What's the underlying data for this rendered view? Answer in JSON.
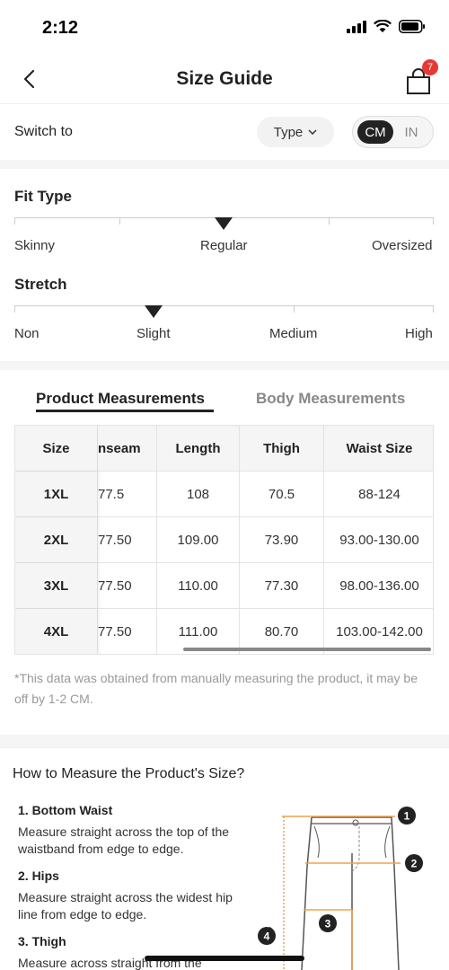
{
  "status_bar": {
    "time": "2:12"
  },
  "nav": {
    "title": "Size Guide",
    "cart_count": "7"
  },
  "switch_row": {
    "label": "Switch to",
    "type_label": "Type",
    "unit_active": "CM",
    "unit_inactive": "IN"
  },
  "fit_type": {
    "title": "Fit Type",
    "labels": [
      "Skinny",
      "Regular",
      "Oversized"
    ],
    "selected": "Regular"
  },
  "stretch": {
    "title": "Stretch",
    "labels": [
      "Non",
      "Slight",
      "Medium",
      "High"
    ],
    "selected": "Slight"
  },
  "tabs": {
    "active": "Product Measurements",
    "inactive": "Body Measurements"
  },
  "table": {
    "headers": [
      "Size",
      "nseam",
      "Length",
      "Thigh",
      "Waist Size"
    ],
    "rows": [
      [
        "1XL",
        "77.5",
        "108",
        "70.5",
        "88-124"
      ],
      [
        "2XL",
        "77.50",
        "109.00",
        "73.90",
        "93.00-130.00"
      ],
      [
        "3XL",
        "77.50",
        "110.00",
        "77.30",
        "98.00-136.00"
      ],
      [
        "4XL",
        "77.50",
        "111.00",
        "80.70",
        "103.00-142.00"
      ]
    ]
  },
  "note": "*This data was obtained from manually measuring the product, it may be off by 1-2 CM.",
  "how_to": {
    "title": "How to Measure the Product's Size?",
    "steps": [
      {
        "title": "1. Bottom Waist",
        "desc": "Measure straight across the top of the waistband from edge to edge."
      },
      {
        "title": "2. Hips",
        "desc": "Measure straight across the widest hip line from edge to edge."
      },
      {
        "title": "3. Thigh",
        "desc": "Measure across straight from the"
      }
    ],
    "diagram_markers": [
      "1",
      "2",
      "3",
      "4"
    ]
  },
  "colors": {
    "accent": "#222222",
    "badge": "#e53935",
    "guide_line": "#f0a050"
  }
}
